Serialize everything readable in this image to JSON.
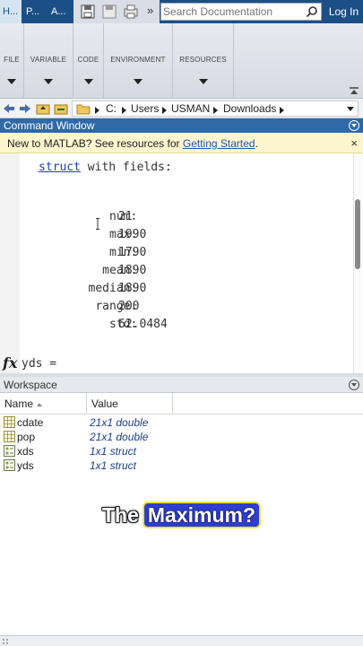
{
  "tabs": [
    {
      "label": "H...",
      "active": true
    },
    {
      "label": "P..."
    },
    {
      "label": "A..."
    }
  ],
  "quick_access": {
    "icons": [
      "save-all-icon",
      "save-icon",
      "print-icon"
    ],
    "more": "»"
  },
  "search": {
    "placeholder": "Search Documentation",
    "value": ""
  },
  "login_label": "Log In",
  "ribbon": {
    "groups": [
      "FILE",
      "VARIABLE",
      "CODE",
      "ENVIRONMENT",
      "RESOURCES"
    ]
  },
  "address": {
    "crumbs": [
      "C:",
      "Users",
      "USMAN",
      "Downloads"
    ]
  },
  "command_window": {
    "title": "Command Window",
    "notice_text": "New to MATLAB? See resources for ",
    "notice_link": "Getting Started",
    "notice_end": ".",
    "notice_close": "×",
    "struct_keyword": "struct",
    "struct_rest": " with fields:",
    "fields": [
      {
        "name": "num:",
        "value": "21"
      },
      {
        "name": "max:",
        "value": "1990"
      },
      {
        "name": "min:",
        "value": "1790"
      },
      {
        "name": "mean:",
        "value": "1890"
      },
      {
        "name": "median:",
        "value": "1890"
      },
      {
        "name": "range:",
        "value": "200"
      },
      {
        "name": "std:",
        "value": "62.0484"
      }
    ],
    "fx_label": "fx",
    "prompt_text": "yds ="
  },
  "workspace": {
    "title": "Workspace",
    "columns": [
      "Name",
      "Value"
    ],
    "rows": [
      {
        "name": "cdate",
        "value": "21x1 double",
        "icon": "matrix-icon"
      },
      {
        "name": "pop",
        "value": "21x1 double",
        "icon": "matrix-icon"
      },
      {
        "name": "xds",
        "value": "1x1 struct",
        "icon": "struct-icon"
      },
      {
        "name": "yds",
        "value": "1x1 struct",
        "icon": "struct-icon"
      }
    ]
  },
  "caption": {
    "plain": "The",
    "highlight": "Maximum?"
  },
  "colors": {
    "title_bar": "#1c4f86",
    "command_header": "#2f69a8",
    "notice_bg": "#fdf6cf",
    "struct_keyword": "#1f3fb3",
    "caption_highlight": "#2e3ecf",
    "caption_border": "#f5e04a"
  }
}
